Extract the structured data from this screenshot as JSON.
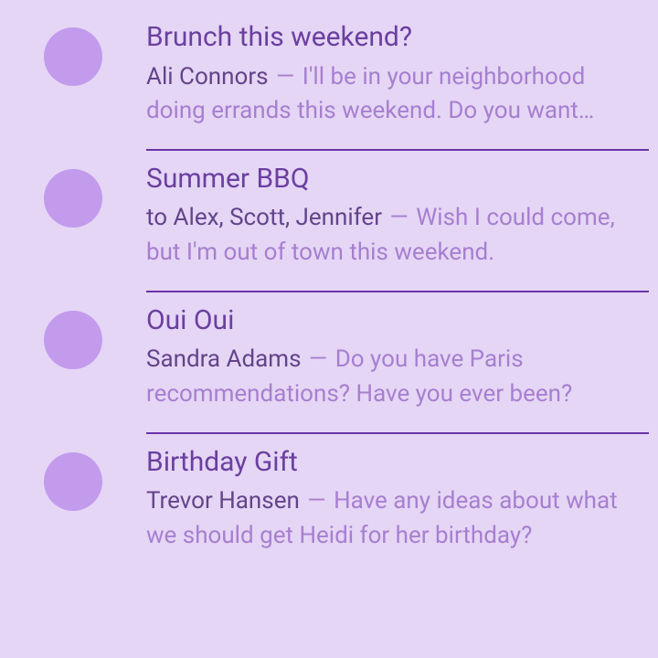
{
  "separator": " — ",
  "messages": [
    {
      "title": "Brunch this weekend?",
      "sender": "Ali Connors",
      "preview": "I'll be in your neighborhood doing errands this weekend. Do you want…"
    },
    {
      "title": "Summer BBQ",
      "sender": "to Alex, Scott, Jennifer",
      "preview": "Wish I could come, but I'm out of town this weekend."
    },
    {
      "title": "Oui Oui",
      "sender": "Sandra Adams",
      "preview": "Do you have Paris recommendations? Have you ever been?"
    },
    {
      "title": "Birthday Gift",
      "sender": "Trevor Hansen",
      "preview": "Have any ideas about what we should get Heidi for her birthday?"
    }
  ]
}
